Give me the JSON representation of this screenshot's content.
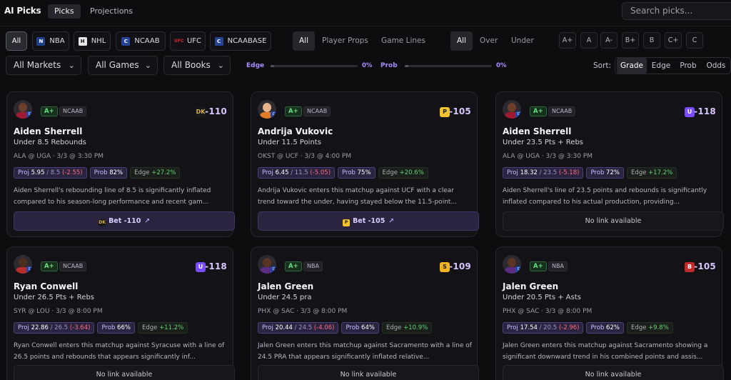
{
  "brand": "AI Picks",
  "nav": {
    "tabs": [
      "Picks",
      "Projections"
    ]
  },
  "search": {
    "placeholder": "Search picks..."
  },
  "leagues": [
    "All",
    "NBA",
    "NHL",
    "NCAAB",
    "UFC",
    "NCAABASE"
  ],
  "market_types": [
    "All",
    "Player Props",
    "Game Lines"
  ],
  "sides": [
    "All",
    "Over",
    "Under"
  ],
  "grades": [
    "A+",
    "A",
    "A-",
    "B+",
    "B",
    "C+",
    "C"
  ],
  "dropdowns": [
    "All Markets",
    "All Games",
    "All Books"
  ],
  "sliders": {
    "edge": {
      "label": "Edge",
      "value": "0%"
    },
    "prob": {
      "label": "Prob",
      "value": "0%"
    }
  },
  "sort": {
    "label": "Sort:",
    "options": [
      "Grade",
      "Edge",
      "Prob",
      "Odds"
    ],
    "active": "Grade"
  },
  "colors": {
    "accent": "#a98cff",
    "grade_green": "#69e07d",
    "negative": "#ff6b7a",
    "positive": "#5fd56f"
  },
  "cards": [
    {
      "grade": "A+",
      "league": "NCAAB",
      "book_icon": "draftkings-icon",
      "book_glyph": "DK",
      "odds": "-110",
      "player": "Aiden Sherrell",
      "line": "Under 8.5 Rebounds",
      "game": "ALA @ UGA · 3/3 @ 3:30 PM",
      "proj_label": "Proj",
      "proj_value": "5.95",
      "proj_line": "/ 8.5",
      "proj_diff": "(-2.55)",
      "prob_label": "Prob",
      "prob_value": "82%",
      "edge_label": "Edge",
      "edge_value": "+27.2%",
      "description": "Aiden Sherrell's rebounding line of 8.5 is significantly inflated compared to his season-long performance and recent gam...",
      "action": "Bet -110",
      "has_link": true
    },
    {
      "grade": "A+",
      "league": "NCAAB",
      "book_icon": "prizepicks-icon",
      "book_glyph": "P",
      "odds": "-105",
      "player": "Andrija Vukovic",
      "line": "Under 11.5 Points",
      "game": "OKST @ UCF · 3/3 @ 4:00 PM",
      "proj_label": "Proj",
      "proj_value": "6.45",
      "proj_line": "/ 11.5",
      "proj_diff": "(-5.05)",
      "prob_label": "Prob",
      "prob_value": "75%",
      "edge_label": "Edge",
      "edge_value": "+20.6%",
      "description": "Andrija Vukovic enters this matchup against UCF with a clear trend toward the under, having stayed below the 11.5-point...",
      "action": "Bet -105",
      "has_link": true
    },
    {
      "grade": "A+",
      "league": "NCAAB",
      "book_icon": "underdog-icon",
      "book_glyph": "U",
      "odds": "-118",
      "player": "Aiden Sherrell",
      "line": "Under 23.5 Pts + Rebs",
      "game": "ALA @ UGA · 3/3 @ 3:30 PM",
      "proj_label": "Proj",
      "proj_value": "18.32",
      "proj_line": "/ 23.5",
      "proj_diff": "(-5.18)",
      "prob_label": "Prob",
      "prob_value": "72%",
      "edge_label": "Edge",
      "edge_value": "+17.2%",
      "description": "Aiden Sherrell's line of 23.5 points and rebounds is significantly inflated compared to his actual production, providing...",
      "action": "No link available",
      "has_link": false
    },
    {
      "grade": "A+",
      "league": "NCAAB",
      "book_icon": "underdog-icon",
      "book_glyph": "U",
      "odds": "-118",
      "player": "Ryan Conwell",
      "line": "Under 26.5 Pts + Rebs",
      "game": "SYR @ LOU · 3/3 @ 8:00 PM",
      "proj_label": "Proj",
      "proj_value": "22.86",
      "proj_line": "/ 26.5",
      "proj_diff": "(-3.64)",
      "prob_label": "Prob",
      "prob_value": "66%",
      "edge_label": "Edge",
      "edge_value": "+11.2%",
      "description": "Ryan Conwell enters this matchup against Syracuse with a line of 26.5 points and rebounds that appears significantly inf...",
      "action": "No link available",
      "has_link": false
    },
    {
      "grade": "A+",
      "league": "NBA",
      "book_icon": "sleeper-icon",
      "book_glyph": "S",
      "odds": "-109",
      "player": "Jalen Green",
      "line": "Under 24.5 pra",
      "game": "PHX @ SAC · 3/3 @ 8:00 PM",
      "proj_label": "Proj",
      "proj_value": "20.44",
      "proj_line": "/ 24.5",
      "proj_diff": "(-4.06)",
      "prob_label": "Prob",
      "prob_value": "64%",
      "edge_label": "Edge",
      "edge_value": "+10.9%",
      "description": "Jalen Green enters this matchup against Sacramento with a line of 24.5 PRA that appears significantly inflated relative...",
      "action": "No link available",
      "has_link": false
    },
    {
      "grade": "A+",
      "league": "NBA",
      "book_icon": "betr-icon",
      "book_glyph": "B",
      "odds": "-105",
      "player": "Jalen Green",
      "line": "Under 20.5 Pts + Asts",
      "game": "PHX @ SAC · 3/3 @ 8:00 PM",
      "proj_label": "Proj",
      "proj_value": "17.54",
      "proj_line": "/ 20.5",
      "proj_diff": "(-2.96)",
      "prob_label": "Prob",
      "prob_value": "62%",
      "edge_label": "Edge",
      "edge_value": "+9.8%",
      "description": "Jalen Green enters this matchup against Sacramento showing a significant downward trend in his combined points and assis...",
      "action": "No link available",
      "has_link": false
    }
  ]
}
